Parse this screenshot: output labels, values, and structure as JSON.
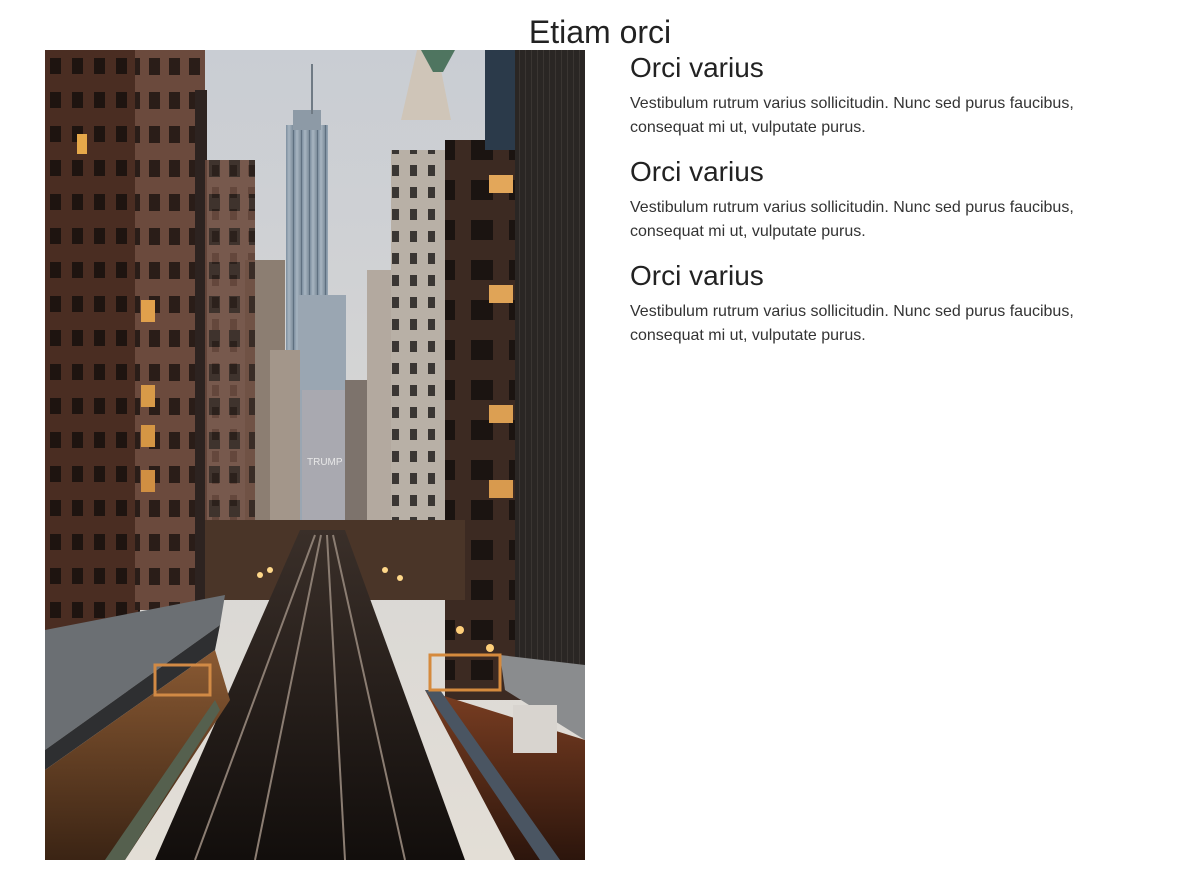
{
  "page": {
    "title": "Etiam orci"
  },
  "photo": {
    "subject": "city-street-elevated-train-tracks",
    "building_sign": "TRUMP"
  },
  "features": [
    {
      "heading": "Orci varius",
      "text": "Vestibulum rutrum varius sollicitudin. Nunc sed purus faucibus, consequat mi ut, vulputate purus."
    },
    {
      "heading": "Orci varius",
      "text": "Vestibulum rutrum varius sollicitudin. Nunc sed purus faucibus, consequat mi ut, vulputate purus."
    },
    {
      "heading": "Orci varius",
      "text": "Vestibulum rutrum varius sollicitudin. Nunc sed purus faucibus, consequat mi ut, vulputate purus."
    }
  ]
}
